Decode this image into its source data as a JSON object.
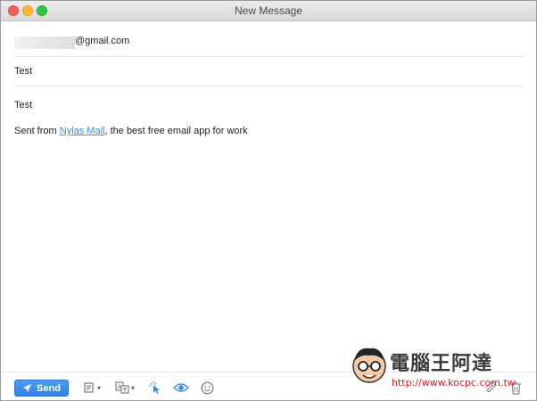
{
  "window": {
    "title": "New Message"
  },
  "to": {
    "address_suffix": "@gmail.com"
  },
  "subject": {
    "value": "Test"
  },
  "body": {
    "line1": "Test",
    "signature_prefix": "Sent from ",
    "signature_link": "Nylas Mail",
    "signature_suffix": ", the best free email app for work"
  },
  "toolbar": {
    "send_label": "Send",
    "icons": [
      "send-icon",
      "template-icon",
      "translate-icon",
      "link-tracking-icon",
      "read-receipt-icon",
      "emoji-icon",
      "attach-icon",
      "trash-icon"
    ],
    "accent": "#2f84e6"
  },
  "watermark": {
    "brand": "電腦王阿達",
    "url": "http://www.kocpc.com.tw"
  }
}
